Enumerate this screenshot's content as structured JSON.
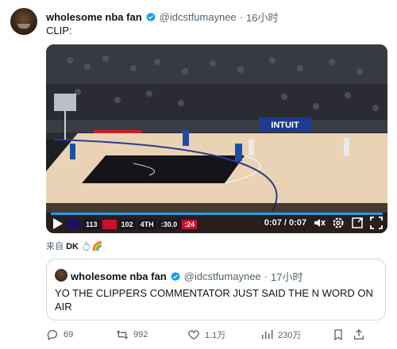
{
  "tweet": {
    "author_name": "wholesome nba fan",
    "author_handle": "@idcstfumaynee",
    "separator": "·",
    "time": "16小时",
    "text": "CLIP:"
  },
  "video": {
    "time_display": "0:07 / 0:07",
    "progress_percent": 100,
    "scoreboard": {
      "away_score": "113",
      "home_score": "102",
      "quarter": "4TH",
      "clock": ":30.0",
      "shot_clock": ":24"
    },
    "arena_sign": "INTUIT",
    "colors": {
      "accent": "#1d9bf0",
      "court": "#e9d3b4",
      "paint": "#14141a"
    }
  },
  "source": {
    "prefix": "来自",
    "label": "DK",
    "emojis": "💍🌈"
  },
  "quote": {
    "author_name": "wholesome nba fan",
    "author_handle": "@idcstfumaynee",
    "separator": "·",
    "time": "17小时",
    "text": "YO THE CLIPPERS COMMENTATOR JUST SAID THE N WORD ON AIR"
  },
  "actions": {
    "reply_count": "69",
    "retweet_count": "992",
    "like_count": "1.1万",
    "view_count": "230万"
  }
}
